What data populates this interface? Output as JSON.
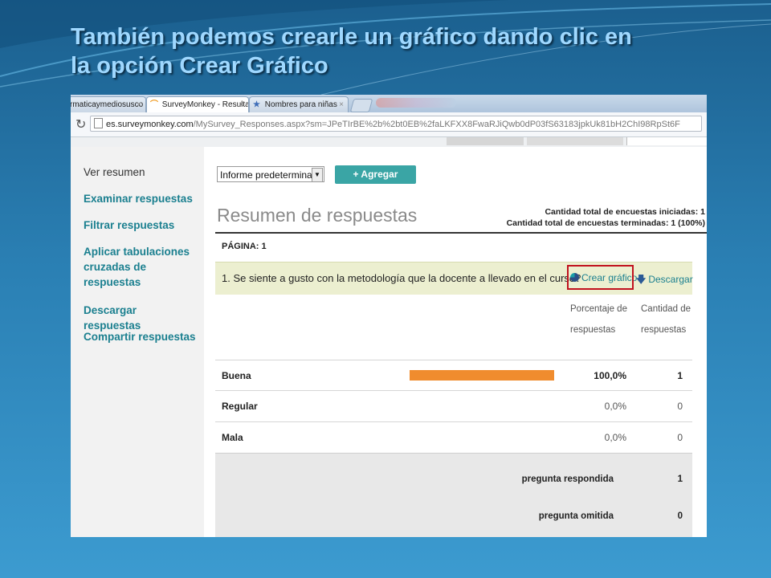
{
  "slide": {
    "title_line1": "También podemos crearle un gráfico dando clic en",
    "title_line2": "la opción Crear Gráfico"
  },
  "browser": {
    "tabs": [
      {
        "label": "rmaticaymediosusco ·",
        "close": "×"
      },
      {
        "label": "SurveyMonkey - Resultado",
        "close": "×",
        "active": true
      },
      {
        "label": "Nombres para niñas",
        "close": "×"
      }
    ],
    "url_host": "es.surveymonkey.com",
    "url_rest": "/MySurvey_Responses.aspx?sm=JPeTIrBE%2b%2bt0EB%2faLKFXX8FwaRJiQwb0dP03fS63183jpkUk81bH2ChI98RpSt6F"
  },
  "sidebar": {
    "items": [
      {
        "label": "Ver resumen",
        "current": true
      },
      {
        "label": "Examinar respuestas"
      },
      {
        "label": "Filtrar respuestas"
      },
      {
        "label": "Aplicar tabulaciones cruzadas de respuestas"
      },
      {
        "label": "Descargar respuestas"
      },
      {
        "label": "Compartir respuestas"
      }
    ]
  },
  "toolbar": {
    "report_select": "Informe predeterminado",
    "add_report": "+ Agregar informe"
  },
  "summary": {
    "title": "Resumen de respuestas",
    "started": "Cantidad total de encuestas iniciadas: 1",
    "finished": "Cantidad total de encuestas terminadas: 1  (100%)",
    "page_label": "PÁGINA: 1"
  },
  "question": {
    "text": "1. Se siente a gusto con la metodología que la docente a llevado en el curso?",
    "create_chart": "Crear gráfico",
    "download": "Descargar",
    "col_percent_1": "Porcentaje de",
    "col_percent_2": "respuestas",
    "col_count_1": "Cantidad de",
    "col_count_2": "respuestas",
    "rows": [
      {
        "label": "Buena",
        "percent": "100,0%",
        "count": "1",
        "fraction": 1.0
      },
      {
        "label": "Regular",
        "percent": "0,0%",
        "count": "0",
        "fraction": 0.0
      },
      {
        "label": "Mala",
        "percent": "0,0%",
        "count": "0",
        "fraction": 0.0
      }
    ],
    "answered_label": "pregunta respondida",
    "answered_value": "1",
    "skipped_label": "pregunta omitida",
    "skipped_value": "0"
  },
  "colors": {
    "bar": "#f08c2e",
    "accent": "#1a7f8f",
    "highlight": "#c1121f"
  }
}
